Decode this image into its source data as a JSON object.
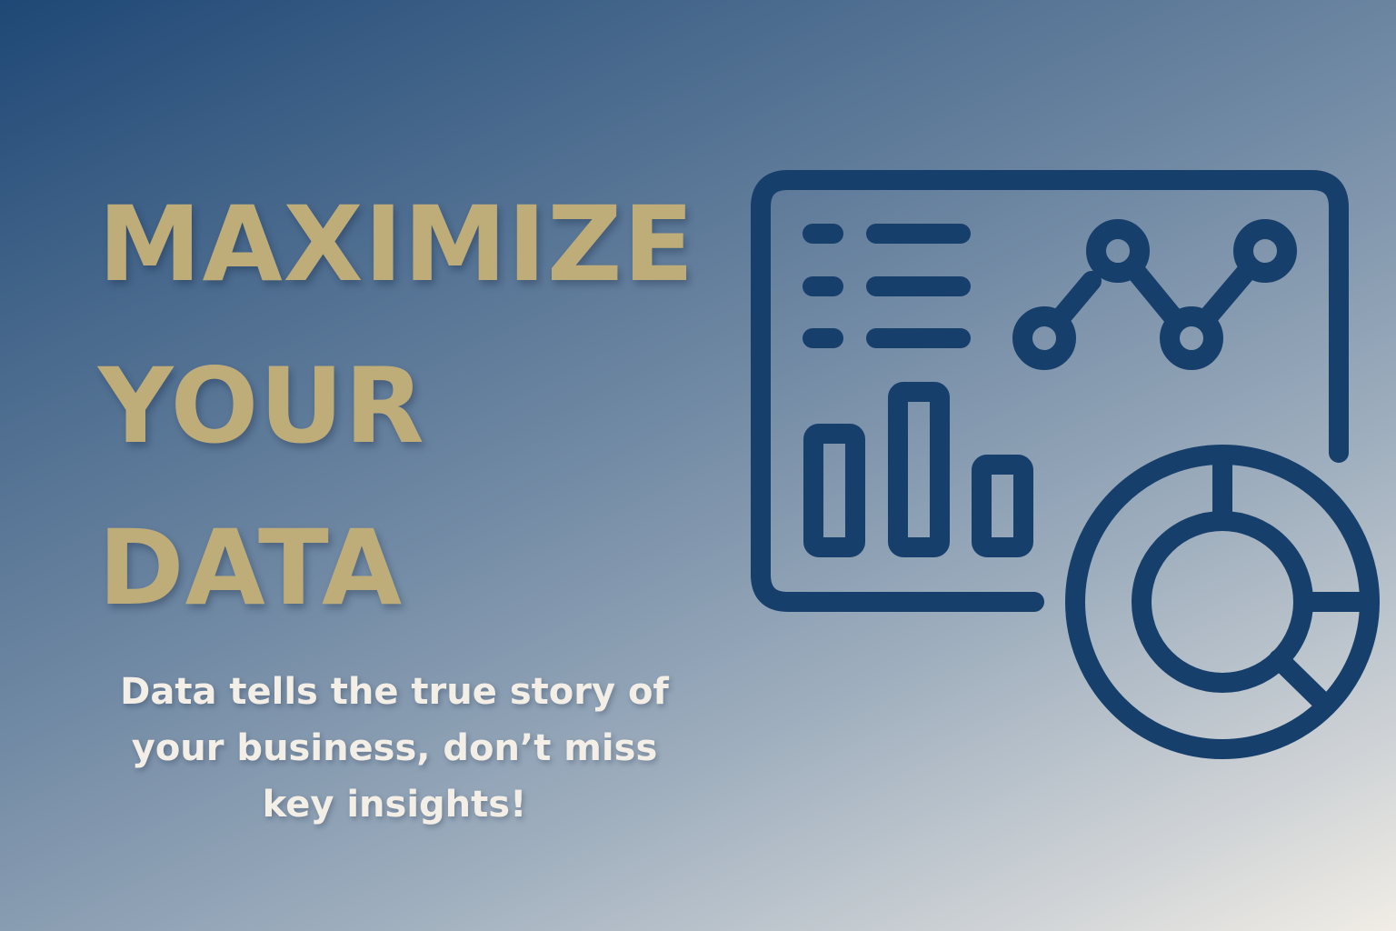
{
  "headline": {
    "line1": "MAXIMIZE",
    "line2": "YOUR",
    "line3": "DATA"
  },
  "tagline": {
    "line1": "Data tells the true story of",
    "line2": "your business, don’t miss",
    "line3": "key insights!"
  },
  "colors": {
    "headline": "#bfad79",
    "tagline": "#f4efe6",
    "icon_stroke": "#173f6c",
    "background_start": "#1f4876",
    "background_end": "#f1ede6"
  },
  "illustration": {
    "icon": "analytics-dashboard-icon"
  }
}
